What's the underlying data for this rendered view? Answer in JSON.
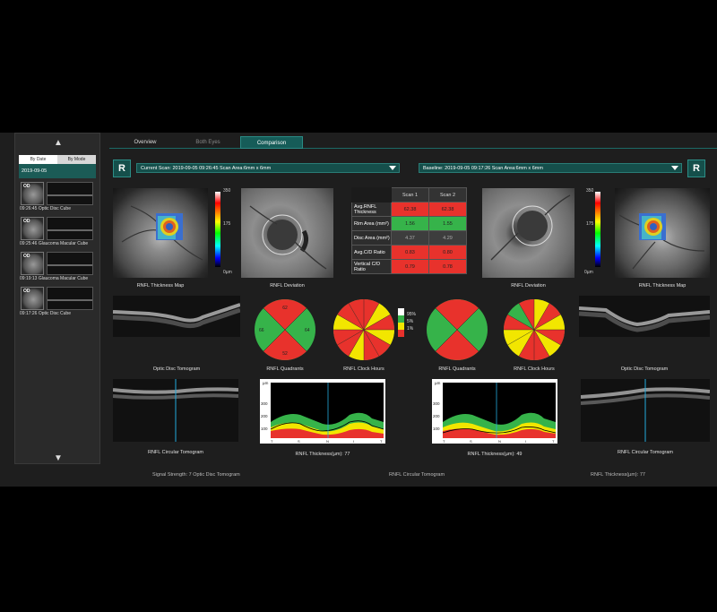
{
  "left_panel": {
    "tabs": [
      "By Date",
      "By Mode"
    ],
    "date": "2019-09-05",
    "items": [
      {
        "thumb_label": "OD",
        "caption": "09:26:45  Optic Disc Cube"
      },
      {
        "thumb_label": "OD",
        "caption": "09:25:46  Glaucoma Macular Cube"
      },
      {
        "thumb_label": "OD",
        "caption": "09:19:13  Glaucoma Macular Cube"
      },
      {
        "thumb_label": "OD",
        "caption": "09:17:26  Optic Disc Cube"
      }
    ]
  },
  "tabs": [
    "Overview",
    "Both Eyes",
    "Comparison"
  ],
  "active_tab": "Comparison",
  "eye_button": "R",
  "current_scan": "Current Scan: 2019-09-05 09:26:45   Scan Area:6mm x 6mm",
  "baseline_scan": "Baseline: 2019-09-05 09:17:26   Scan Area:6mm x 6mm",
  "colorbar": {
    "top": "350",
    "mid": "175",
    "bottom": "0µm"
  },
  "table": {
    "headers": [
      "Scan 1",
      "Scan 2"
    ],
    "rows": [
      {
        "label": "Avg.RNFL Thickness",
        "v1": "62.38",
        "v2": "62.38",
        "c1": "#e8322c",
        "c2": "#e8322c"
      },
      {
        "label": "Rim Area (mm²)",
        "v1": "1.56",
        "v2": "1.55",
        "c1": "#36b34a",
        "c2": "#36b34a"
      },
      {
        "label": "Disc Area (mm²)",
        "v1": "4.37",
        "v2": "4.29",
        "c1": "#3d3d3d",
        "c2": "#3d3d3d"
      },
      {
        "label": "Avg.C/D Ratio",
        "v1": "0.83",
        "v2": "0.80",
        "c1": "#e8322c",
        "c2": "#e8322c"
      },
      {
        "label": "Vertical C/D Ratio",
        "v1": "0.79",
        "v2": "0.78",
        "c1": "#e8322c",
        "c2": "#e8322c"
      }
    ]
  },
  "captions": {
    "thickness_map": "RNFL Thickness Map",
    "deviation": "RNFL Deviation",
    "optic_disc_tomogram": "Optic Disc Tomogram",
    "quadrants": "RNFL Quadrants",
    "clock_hours": "RNFL Clock Hours",
    "circular_tomogram": "RNFL Circular Tomogram",
    "thickness_left": "RNFL Thickness(µm): 77",
    "thickness_right": "RNFL Thickness(µm): 49"
  },
  "quadrant_values": {
    "top": "62",
    "left": "66",
    "right": "64",
    "bottom": "52"
  },
  "legend": [
    "95%",
    "5%",
    "1%"
  ],
  "legend_colors": [
    "#ffffff",
    "#36b34a",
    "#f2e600",
    "#e8322c"
  ],
  "graph": {
    "unit": "µm",
    "y_ticks": [
      "300",
      "200",
      "100"
    ],
    "x_ticks": [
      "T",
      "S",
      "N",
      "I",
      "T"
    ]
  },
  "footer": {
    "left": "Signal Strength: 7   Optic Disc Tomogram",
    "center": "RNFL Circular Tomogram",
    "right": "RNFL Thickness(µm): 77"
  }
}
